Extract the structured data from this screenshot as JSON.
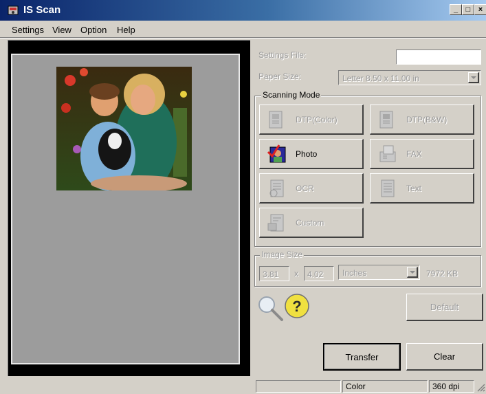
{
  "window": {
    "title": "IS Scan",
    "minimize": "_",
    "maximize": "□",
    "close": "×"
  },
  "menu": [
    "Settings",
    "View",
    "Option",
    "Help"
  ],
  "menu_underline": [
    "e",
    "V",
    "O",
    "H"
  ],
  "settings_file": {
    "label": "Settings File:",
    "value": ""
  },
  "paper_size": {
    "label": "Paper Size:",
    "value": "Letter 8.50 x 11.00 in"
  },
  "scanning_mode": {
    "label": "Scanning Mode",
    "modes": [
      "DTP(Color)",
      "DTP(B&W)",
      "Photo",
      "FAX",
      "OCR",
      "Text",
      "Custom"
    ],
    "selected": "Photo"
  },
  "image_size": {
    "label": "Image Size",
    "width": "3.81",
    "sep": "x",
    "height": "4.02",
    "unit": "Inches",
    "filesize": "7972 KB"
  },
  "buttons": {
    "default": "Default",
    "transfer": "Transfer",
    "clear": "Clear"
  },
  "status": {
    "cell1": "",
    "mode": "Color",
    "dpi": "360 dpi"
  },
  "icons": {
    "zoom": "magnifier-icon",
    "help": "question-icon"
  }
}
